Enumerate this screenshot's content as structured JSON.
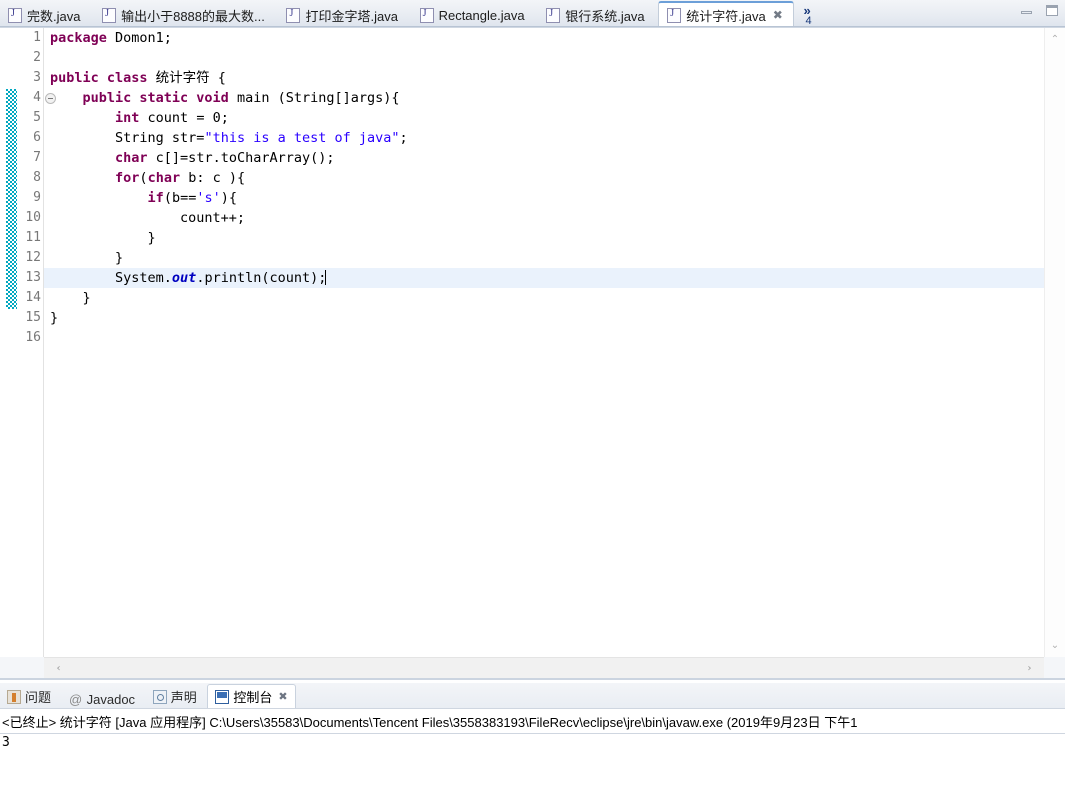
{
  "window": {
    "minimize_label": "Minimize",
    "maximize_label": "Maximize"
  },
  "editor": {
    "tabs": [
      {
        "label": "完数.java",
        "icon": "java-file-icon",
        "active": false,
        "closable": false
      },
      {
        "label": "输出小于8888的最大数...",
        "icon": "java-file-icon",
        "active": false,
        "closable": false
      },
      {
        "label": "打印金字塔.java",
        "icon": "java-file-icon",
        "active": false,
        "closable": false
      },
      {
        "label": "Rectangle.java",
        "icon": "java-file-icon",
        "active": false,
        "closable": false
      },
      {
        "label": "银行系统.java",
        "icon": "java-file-icon",
        "active": false,
        "closable": false
      },
      {
        "label": "统计字符.java",
        "icon": "java-file-icon",
        "active": true,
        "closable": true
      }
    ],
    "close_glyph": "✖",
    "overflow": {
      "chevron": "»",
      "count": "4"
    },
    "line_numbers": [
      "1",
      "2",
      "3",
      "4",
      "5",
      "6",
      "7",
      "8",
      "9",
      "10",
      "11",
      "12",
      "13",
      "14",
      "15",
      "16"
    ],
    "current_line": 13,
    "fold_marker_line": 4,
    "change_bar_from_line": 4,
    "change_bar_to_line": 14,
    "code_lines": [
      {
        "n": 1,
        "tokens": [
          {
            "t": "kw",
            "v": "package"
          },
          {
            "t": "plain",
            "v": " Domon1;"
          }
        ]
      },
      {
        "n": 2,
        "tokens": []
      },
      {
        "n": 3,
        "tokens": [
          {
            "t": "kw",
            "v": "public class"
          },
          {
            "t": "plain",
            "v": " 统计字符 {"
          }
        ]
      },
      {
        "n": 4,
        "tokens": [
          {
            "t": "plain",
            "v": "    "
          },
          {
            "t": "kw",
            "v": "public static void"
          },
          {
            "t": "plain",
            "v": " main (String[]args){"
          }
        ]
      },
      {
        "n": 5,
        "tokens": [
          {
            "t": "plain",
            "v": "        "
          },
          {
            "t": "kw",
            "v": "int"
          },
          {
            "t": "plain",
            "v": " count = 0;"
          }
        ]
      },
      {
        "n": 6,
        "tokens": [
          {
            "t": "plain",
            "v": "        String str="
          },
          {
            "t": "str",
            "v": "\"this is a test of java\""
          },
          {
            "t": "plain",
            "v": ";"
          }
        ]
      },
      {
        "n": 7,
        "tokens": [
          {
            "t": "plain",
            "v": "        "
          },
          {
            "t": "kw",
            "v": "char"
          },
          {
            "t": "plain",
            "v": " c[]=str.toCharArray();"
          }
        ]
      },
      {
        "n": 8,
        "tokens": [
          {
            "t": "plain",
            "v": "        "
          },
          {
            "t": "kw",
            "v": "for"
          },
          {
            "t": "plain",
            "v": "("
          },
          {
            "t": "kw",
            "v": "char"
          },
          {
            "t": "plain",
            "v": " b: c ){"
          }
        ]
      },
      {
        "n": 9,
        "tokens": [
          {
            "t": "plain",
            "v": "            "
          },
          {
            "t": "kw",
            "v": "if"
          },
          {
            "t": "plain",
            "v": "(b=="
          },
          {
            "t": "str",
            "v": "'s'"
          },
          {
            "t": "plain",
            "v": "){"
          }
        ]
      },
      {
        "n": 10,
        "tokens": [
          {
            "t": "plain",
            "v": "                count++;"
          }
        ]
      },
      {
        "n": 11,
        "tokens": [
          {
            "t": "plain",
            "v": "            }"
          }
        ]
      },
      {
        "n": 12,
        "tokens": [
          {
            "t": "plain",
            "v": "        }"
          }
        ]
      },
      {
        "n": 13,
        "tokens": [
          {
            "t": "plain",
            "v": "        System."
          },
          {
            "t": "fld",
            "v": "out"
          },
          {
            "t": "plain",
            "v": ".println(count);"
          }
        ],
        "caret": true
      },
      {
        "n": 14,
        "tokens": [
          {
            "t": "plain",
            "v": "    }"
          }
        ]
      },
      {
        "n": 15,
        "tokens": [
          {
            "t": "plain",
            "v": "}"
          }
        ]
      },
      {
        "n": 16,
        "tokens": []
      }
    ],
    "scroll": {
      "up_arrow": "⌃",
      "down_arrow": "⌄",
      "left_arrow": "‹",
      "right_arrow": "›"
    }
  },
  "console": {
    "tabs": [
      {
        "label": "问题",
        "icon": "problems-icon",
        "active": false,
        "closable": false
      },
      {
        "label": "Javadoc",
        "icon": "javadoc-icon",
        "active": false,
        "closable": false
      },
      {
        "label": "声明",
        "icon": "declaration-icon",
        "active": false,
        "closable": false
      },
      {
        "label": "控制台",
        "icon": "console-icon",
        "active": true,
        "closable": true
      }
    ],
    "close_glyph": "✖",
    "header": "<已终止> 统计字符 [Java 应用程序] C:\\Users\\35583\\Documents\\Tencent Files\\3558383193\\FileRecv\\eclipse\\jre\\bin\\javaw.exe  (2019年9月23日 下午1",
    "output": "3"
  },
  "colors": {
    "keyword": "#7F0055",
    "string": "#2A00FF",
    "field": "#0000C0",
    "current_line_bg": "#EAF2FC",
    "change_bar": "#00A8C0",
    "active_tab_top_border": "#6C9FD8"
  }
}
